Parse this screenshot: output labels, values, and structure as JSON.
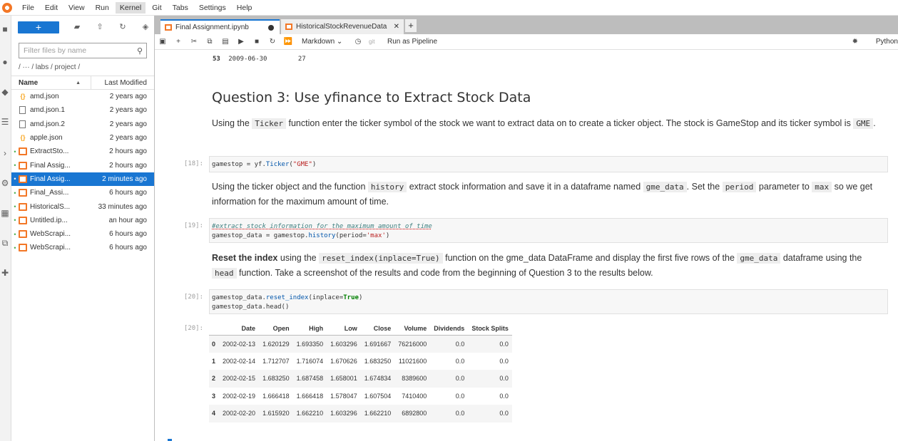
{
  "menubar": {
    "items": [
      "File",
      "Edit",
      "View",
      "Run",
      "Kernel",
      "Git",
      "Tabs",
      "Settings",
      "Help"
    ],
    "active": "Kernel"
  },
  "filebrowser": {
    "new_button": "+",
    "search_placeholder": "Filter files by name",
    "breadcrumb": "/ ··· / labs / project /",
    "col_name": "Name",
    "col_modified": "Last Modified",
    "files": [
      {
        "name": "amd.json",
        "modified": "2 years ago",
        "type": "json",
        "running": false
      },
      {
        "name": "amd.json.1",
        "modified": "2 years ago",
        "type": "file",
        "running": false
      },
      {
        "name": "amd.json.2",
        "modified": "2 years ago",
        "type": "file",
        "running": false
      },
      {
        "name": "apple.json",
        "modified": "2 years ago",
        "type": "json",
        "running": false
      },
      {
        "name": "ExtractSto...",
        "modified": "2 hours ago",
        "type": "notebook",
        "running": true
      },
      {
        "name": "Final Assig...",
        "modified": "2 hours ago",
        "type": "notebook",
        "running": true
      },
      {
        "name": "Final Assig...",
        "modified": "2 minutes ago",
        "type": "notebook",
        "running": true,
        "selected": true
      },
      {
        "name": "Final_Assi...",
        "modified": "6 hours ago",
        "type": "notebook",
        "running": true
      },
      {
        "name": "HistoricalS...",
        "modified": "33 minutes ago",
        "type": "notebook",
        "running": true
      },
      {
        "name": "Untitled.ip...",
        "modified": "an hour ago",
        "type": "notebook",
        "running": true
      },
      {
        "name": "WebScrapi...",
        "modified": "6 hours ago",
        "type": "notebook",
        "running": true
      },
      {
        "name": "WebScrapi...",
        "modified": "6 hours ago",
        "type": "notebook",
        "running": true
      }
    ]
  },
  "tabs": [
    {
      "label": "Final Assignment.ipynb",
      "active": true
    },
    {
      "label": "HistoricalStockRevenueData",
      "active": false
    }
  ],
  "nbtoolbar": {
    "cell_type": "Markdown",
    "git": "git",
    "pipeline": "Run as Pipeline",
    "kernel": "Python"
  },
  "notebook": {
    "prev_output": {
      "index": "53",
      "date": "2009-06-30",
      "value": "27"
    },
    "question_title": "Question 3: Use yfinance to Extract Stock Data",
    "md1": {
      "t1": "Using the ",
      "c1": "Ticker",
      "t2": " function enter the ticker symbol of the stock we want to extract data on to create a ticker object. The stock is GameStop and its ticker symbol is ",
      "c2": "GME",
      "t3": "."
    },
    "cell18": {
      "prompt": "[18]:",
      "line1_a": "gamestop = yf.",
      "line1_fn": "Ticker",
      "line1_b": "(",
      "line1_str": "\"GME\"",
      "line1_c": ")"
    },
    "md2": {
      "t1": "Using the ticker object and the function ",
      "c1": "history",
      "t2": " extract stock information and save it in a dataframe named ",
      "c2": "gme_data",
      "t3": ". Set the ",
      "c3": "period",
      "t4": " parameter to ",
      "c4": "max",
      "t5": " so we get information for the maximum amount of time."
    },
    "cell19": {
      "prompt": "[19]:",
      "comment": "#extract stock information for the maximum amount of time",
      "line2_a": "gamestop_data = gamestop.",
      "line2_fn": "history",
      "line2_b": "(period=",
      "line2_str": "'max'",
      "line2_c": ")"
    },
    "md3": {
      "b1": "Reset the index",
      "t1": " using the ",
      "c1": "reset_index(inplace=True)",
      "t2": " function on the gme_data DataFrame and display the first five rows of the ",
      "c2": "gme_data",
      "t3": " dataframe using the ",
      "c3": "head",
      "t4": " function. Take a screenshot of the results and code from the beginning of Question 3 to the results below."
    },
    "cell20": {
      "prompt": "[20]:",
      "line1_a": "gamestop_data.",
      "line1_fn": "reset_index",
      "line1_b": "(inplace=",
      "line1_kw": "True",
      "line1_c": ")",
      "line2": "gamestop_data.head()"
    },
    "output20": {
      "prompt": "[20]:",
      "columns": [
        "",
        "Date",
        "Open",
        "High",
        "Low",
        "Close",
        "Volume",
        "Dividends",
        "Stock Splits"
      ],
      "rows": [
        [
          "0",
          "2002-02-13",
          "1.620129",
          "1.693350",
          "1.603296",
          "1.691667",
          "76216000",
          "0.0",
          "0.0"
        ],
        [
          "1",
          "2002-02-14",
          "1.712707",
          "1.716074",
          "1.670626",
          "1.683250",
          "11021600",
          "0.0",
          "0.0"
        ],
        [
          "2",
          "2002-02-15",
          "1.683250",
          "1.687458",
          "1.658001",
          "1.674834",
          "8389600",
          "0.0",
          "0.0"
        ],
        [
          "3",
          "2002-02-19",
          "1.666418",
          "1.666418",
          "1.578047",
          "1.607504",
          "7410400",
          "0.0",
          "0.0"
        ],
        [
          "4",
          "2002-02-20",
          "1.615920",
          "1.662210",
          "1.603296",
          "1.662210",
          "6892800",
          "0.0",
          "0.0"
        ]
      ]
    }
  }
}
